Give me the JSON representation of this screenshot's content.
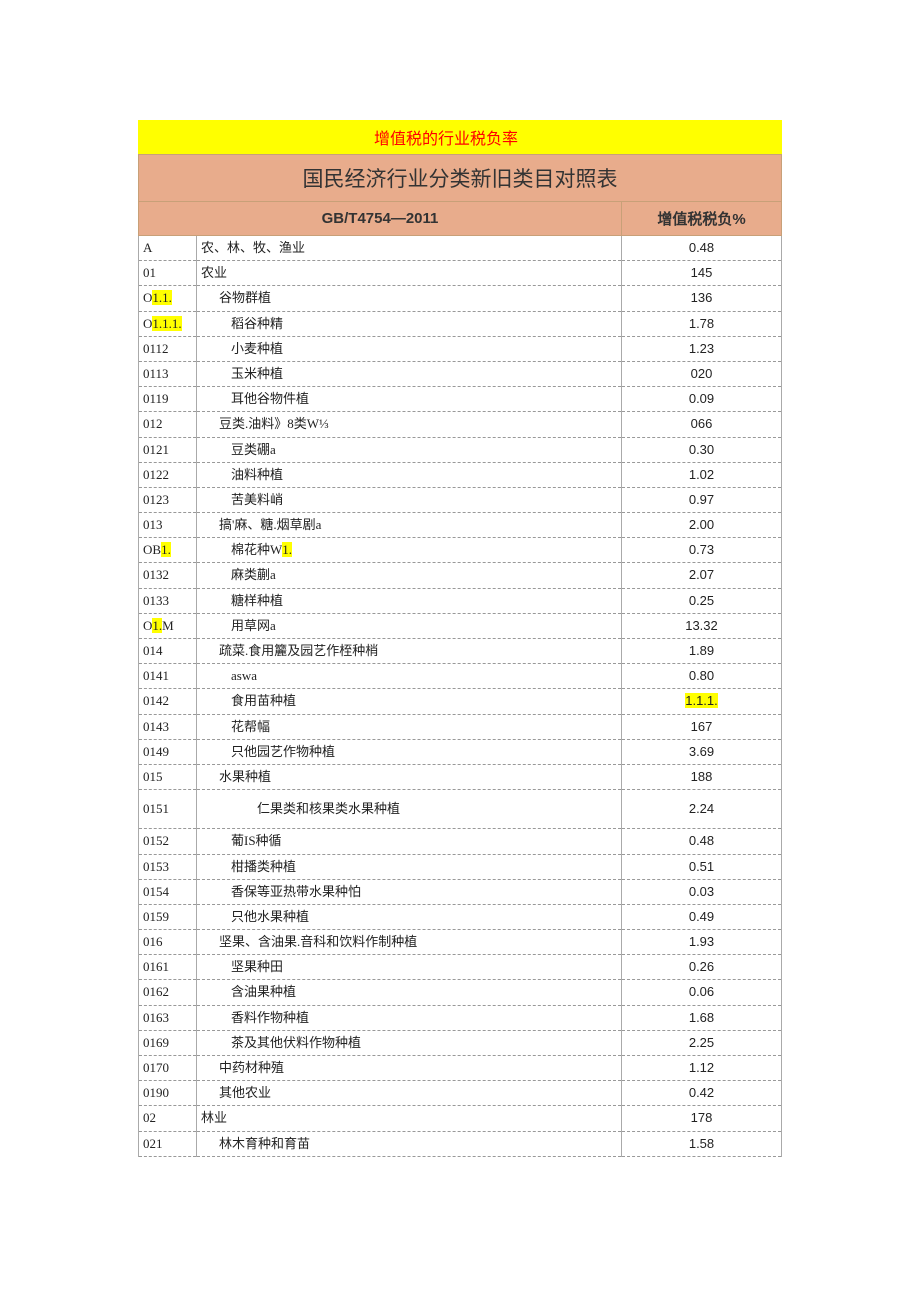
{
  "banner": "增值税的行业税负率",
  "title": "国民经济行业分类新旧类目对照表",
  "header": {
    "left": "GB/T4754—2011",
    "right": "增值税税负%"
  },
  "rows": [
    {
      "code": "A",
      "code_hl": "",
      "name": "农、林、牧、渔业",
      "indent": 0,
      "val": "0.48",
      "val_hl": false
    },
    {
      "code": "01",
      "code_hl": "",
      "name": "农业",
      "indent": 0,
      "val": "145",
      "val_hl": false
    },
    {
      "code": "O",
      "code_hl": "1.1.",
      "name": "谷物群植",
      "indent": 1,
      "val": "136",
      "val_hl": false
    },
    {
      "code": "O",
      "code_hl": "1.1.1.",
      "name": "稻谷种精",
      "indent": 2,
      "val": "1.78",
      "val_hl": false
    },
    {
      "code": "0112",
      "code_hl": "",
      "name": "小麦种植",
      "indent": 2,
      "val": "1.23",
      "val_hl": false
    },
    {
      "code": "0113",
      "code_hl": "",
      "name": "玉米种植",
      "indent": 2,
      "val": "020",
      "val_hl": false
    },
    {
      "code": "0119",
      "code_hl": "",
      "name": "耳他谷物件植",
      "indent": 2,
      "val": "0.09",
      "val_hl": false
    },
    {
      "code": "012",
      "code_hl": "",
      "name": "豆类.油料》8类W⅓",
      "indent": 1,
      "val": "066",
      "val_hl": false
    },
    {
      "code": "0121",
      "code_hl": "",
      "name": "豆类硼a",
      "indent": 2,
      "val": "0.30",
      "val_hl": false
    },
    {
      "code": "0122",
      "code_hl": "",
      "name": "油料种植",
      "indent": 2,
      "val": "1.02",
      "val_hl": false
    },
    {
      "code": "0123",
      "code_hl": "",
      "name": "苦美料峭",
      "indent": 2,
      "val": "0.97",
      "val_hl": false
    },
    {
      "code": "013",
      "code_hl": "",
      "name": "搞'麻、糖.烟草剧a",
      "indent": 1,
      "val": "2.00",
      "val_hl": false
    },
    {
      "code": "OB",
      "code_hl": "1.",
      "name": "棉花种W",
      "name_hl": "1.",
      "indent": 2,
      "val": "0.73",
      "val_hl": false
    },
    {
      "code": "0132",
      "code_hl": "",
      "name": "麻类蒯a",
      "indent": 2,
      "val": "2.07",
      "val_hl": false
    },
    {
      "code": "0133",
      "code_hl": "",
      "name": "糖样种植",
      "indent": 2,
      "val": "0.25",
      "val_hl": false
    },
    {
      "code": "O",
      "code_hl": "1.",
      "code_suffix": "M",
      "name": "用草网a",
      "indent": 2,
      "val": "13.32",
      "val_hl": false
    },
    {
      "code": "014",
      "code_hl": "",
      "name": "疏菜.食用籭及园艺作桎种梢",
      "indent": 1,
      "val": "1.89",
      "val_hl": false
    },
    {
      "code": "0141",
      "code_hl": "",
      "name": "aswa",
      "indent": 2,
      "val": "0.80",
      "val_hl": false
    },
    {
      "code": "0142",
      "code_hl": "",
      "name": "食用苗种植",
      "indent": 2,
      "val": "1.1.1.",
      "val_hl": true
    },
    {
      "code": "0143",
      "code_hl": "",
      "name": "花帮幅",
      "indent": 2,
      "val": "167",
      "val_hl": false
    },
    {
      "code": "0149",
      "code_hl": "",
      "name": "只他园艺作物种植",
      "indent": 2,
      "val": "3.69",
      "val_hl": false
    },
    {
      "code": "015",
      "code_hl": "",
      "name": "水果种植",
      "indent": 1,
      "val": "188",
      "val_hl": false
    },
    {
      "code": "0151",
      "code_hl": "",
      "name": "仁果类和核果类水果种植",
      "indent": 3,
      "val": "2.24",
      "val_hl": false,
      "tall": true
    },
    {
      "code": "0152",
      "code_hl": "",
      "name": "葡IS种循",
      "indent": 2,
      "val": "0.48",
      "val_hl": false
    },
    {
      "code": "0153",
      "code_hl": "",
      "name": "柑播类种植",
      "indent": 2,
      "val": "0.51",
      "val_hl": false
    },
    {
      "code": "0154",
      "code_hl": "",
      "name": "香保等亚热带水果种怕",
      "indent": 2,
      "val": "0.03",
      "val_hl": false
    },
    {
      "code": "0159",
      "code_hl": "",
      "name": "只他水果种植",
      "indent": 2,
      "val": "0.49",
      "val_hl": false
    },
    {
      "code": "016",
      "code_hl": "",
      "name": "坚果、含油果.音科和饮料作制种植",
      "indent": 1,
      "val": "1.93",
      "val_hl": false
    },
    {
      "code": "0161",
      "code_hl": "",
      "name": "坚果种田",
      "indent": 2,
      "val": "0.26",
      "val_hl": false
    },
    {
      "code": "0162",
      "code_hl": "",
      "name": "含油果种植",
      "indent": 2,
      "val": "0.06",
      "val_hl": false
    },
    {
      "code": "0163",
      "code_hl": "",
      "name": "香料作物种植",
      "indent": 2,
      "val": "1.68",
      "val_hl": false
    },
    {
      "code": "0169",
      "code_hl": "",
      "name": "茶及其他伏料作物种植",
      "indent": 2,
      "val": "2.25",
      "val_hl": false
    },
    {
      "code": "0170",
      "code_hl": "",
      "name": "中药材种殖",
      "indent": 1,
      "val": "1.12",
      "val_hl": false
    },
    {
      "code": "0190",
      "code_hl": "",
      "name": "其他农业",
      "indent": 1,
      "val": "0.42",
      "val_hl": false
    },
    {
      "code": "02",
      "code_hl": "",
      "name": "林业",
      "indent": 0,
      "val": "178",
      "val_hl": false
    },
    {
      "code": "021",
      "code_hl": "",
      "name": "林木育种和育苗",
      "indent": 1,
      "val": "1.58",
      "val_hl": false
    }
  ]
}
